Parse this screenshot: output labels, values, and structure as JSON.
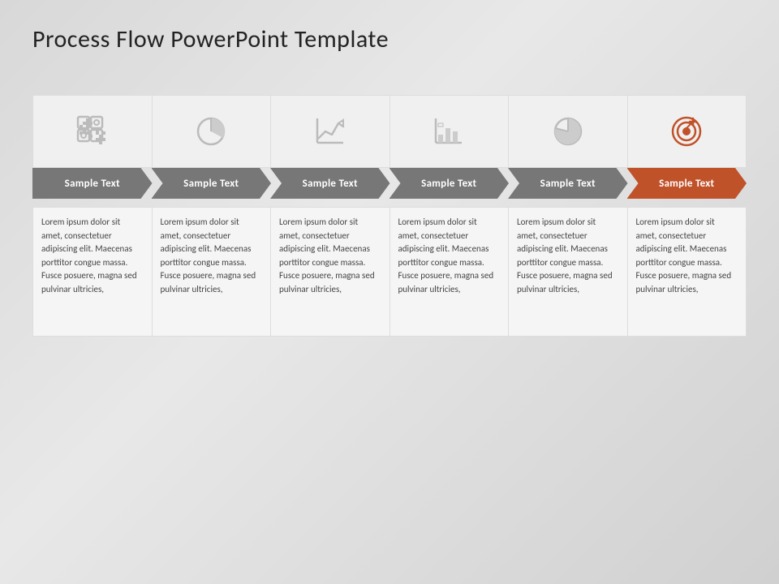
{
  "title": "Process Flow PowerPoint Template",
  "steps": [
    {
      "id": 1,
      "icon": "puzzle",
      "label": "Sample Text",
      "description": "Lorem ipsum dolor sit amet, consectetuer adipiscing elit. Maecenas porttitor congue massa. Fusce posuere, magna sed pulvinar ultricies,"
    },
    {
      "id": 2,
      "icon": "pie",
      "label": "Sample Text",
      "description": "Lorem ipsum dolor sit amet, consectetuer adipiscing elit. Maecenas porttitor congue massa. Fusce posuere, magna sed pulvinar ultricies,"
    },
    {
      "id": 3,
      "icon": "line-chart",
      "label": "Sample Text",
      "description": "Lorem ipsum dolor sit amet, consectetuer adipiscing elit. Maecenas porttitor congue massa. Fusce posuere, magna sed pulvinar ultricies,"
    },
    {
      "id": 4,
      "icon": "bar-chart",
      "label": "Sample Text",
      "description": "Lorem ipsum dolor sit amet, consectetuer adipiscing elit. Maecenas porttitor congue massa. Fusce posuere, magna sed pulvinar ultricies,"
    },
    {
      "id": 5,
      "icon": "pie2",
      "label": "Sample Text",
      "description": "Lorem ipsum dolor sit amet, consectetuer adipiscing elit. Maecenas porttitor congue massa. Fusce posuere, magna sed pulvinar ultricies,"
    },
    {
      "id": 6,
      "icon": "target",
      "label": "Sample Text",
      "description": "Lorem ipsum dolor sit amet, consectetuer adipiscing elit. Maecenas porttitor congue massa. Fusce posuere, magna sed pulvinar ultricies,"
    }
  ]
}
